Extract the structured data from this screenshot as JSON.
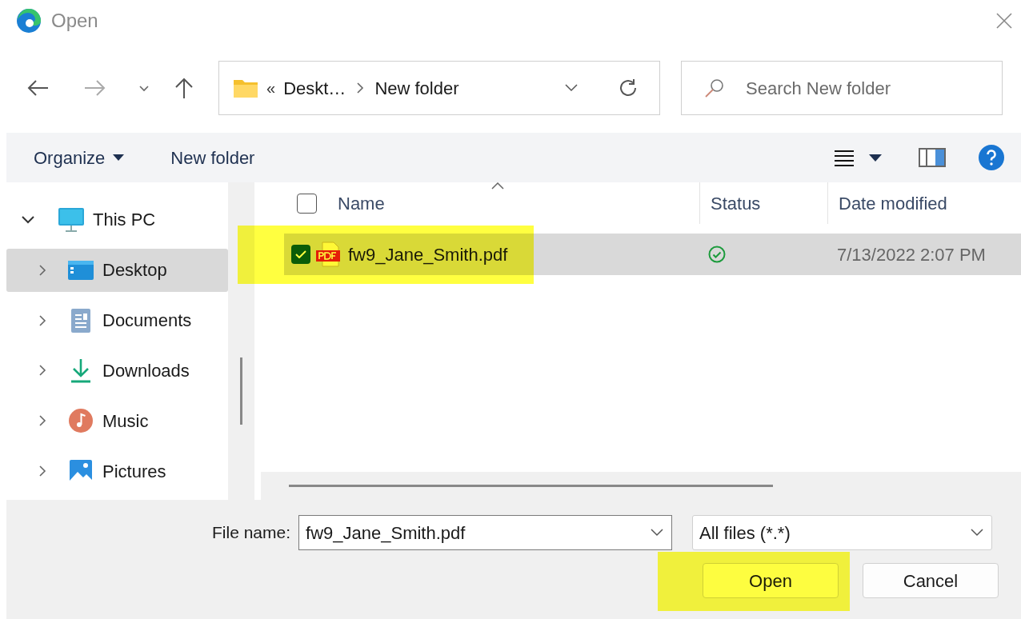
{
  "window": {
    "title": "Open"
  },
  "address": {
    "overflow": "«",
    "crumbs": [
      "Deskt…",
      "New folder"
    ]
  },
  "search": {
    "placeholder": "Search New folder"
  },
  "toolbar": {
    "buttons": [
      {
        "label": "Organize",
        "dropdown": true
      },
      {
        "label": "New folder",
        "dropdown": false
      }
    ]
  },
  "sidebar": {
    "items": [
      {
        "label": "This PC",
        "kind": "pc",
        "expanded": true,
        "selected": false,
        "children": [
          {
            "label": "Desktop",
            "kind": "desktop",
            "expanded": false,
            "selected": true
          },
          {
            "label": "Documents",
            "kind": "documents",
            "expanded": false,
            "selected": false
          },
          {
            "label": "Downloads",
            "kind": "downloads",
            "expanded": false,
            "selected": false
          },
          {
            "label": "Music",
            "kind": "music",
            "expanded": false,
            "selected": false
          },
          {
            "label": "Pictures",
            "kind": "pictures",
            "expanded": false,
            "selected": false
          }
        ]
      }
    ]
  },
  "file_list": {
    "columns": [
      "Name",
      "Status",
      "Date modified"
    ],
    "select_all_checked": false,
    "rows": [
      {
        "name": "fw9_Jane_Smith.pdf",
        "kind": "pdf",
        "checked": true,
        "selected": true,
        "highlighted": true,
        "date": "7/13/2022 2:07 PM"
      }
    ]
  },
  "file_name": {
    "label": "File name:",
    "value": "fw9_Jane_Smith.pdf"
  },
  "file_type": {
    "value": "All files (*.*)"
  },
  "buttons": [
    {
      "label": "Open",
      "highlighted": true
    },
    {
      "label": "Cancel",
      "highlighted": false
    }
  ]
}
